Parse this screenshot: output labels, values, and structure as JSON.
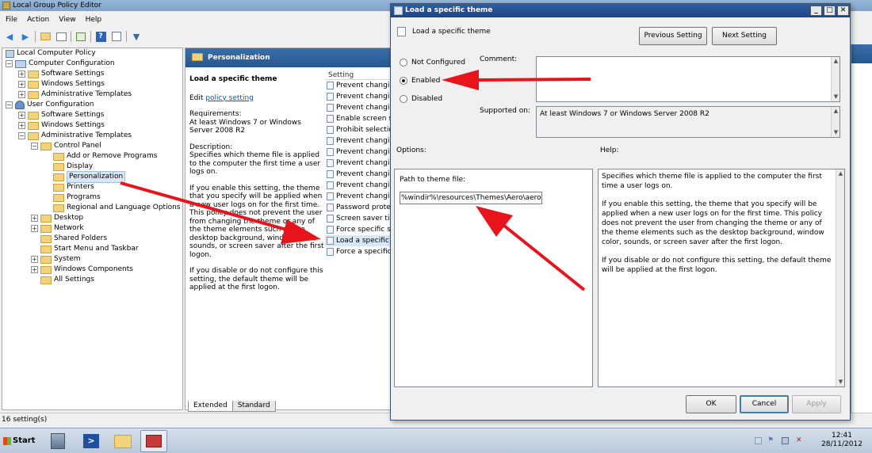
{
  "main_window": {
    "title": "Local Group Policy Editor",
    "menu": [
      "File",
      "Action",
      "View",
      "Help"
    ],
    "toolbar_icons": [
      "back-arrow-icon",
      "forward-arrow-icon",
      "up-folder-icon",
      "show-hide-tree-icon",
      "export-list-icon",
      "help-icon",
      "properties-icon",
      "filter-icon"
    ],
    "tree": [
      {
        "label": "Local Computer Policy",
        "icon": "policy-icon"
      },
      {
        "label": "Computer Configuration",
        "icon": "computer-icon"
      },
      {
        "label": "Software Settings",
        "icon": "folder-icon"
      },
      {
        "label": "Windows Settings",
        "icon": "folder-icon"
      },
      {
        "label": "Administrative Templates",
        "icon": "folder-icon"
      },
      {
        "label": "User Configuration",
        "icon": "user-icon"
      },
      {
        "label": "Software Settings",
        "icon": "folder-icon"
      },
      {
        "label": "Windows Settings",
        "icon": "folder-icon"
      },
      {
        "label": "Administrative Templates",
        "icon": "folder-icon"
      },
      {
        "label": "Control Panel",
        "icon": "folder-icon"
      },
      {
        "label": "Add or Remove Programs",
        "icon": "folder-icon"
      },
      {
        "label": "Display",
        "icon": "folder-icon"
      },
      {
        "label": "Personalization",
        "icon": "folder-icon",
        "selected": true
      },
      {
        "label": "Printers",
        "icon": "folder-icon"
      },
      {
        "label": "Programs",
        "icon": "folder-icon"
      },
      {
        "label": "Regional and Language Options",
        "icon": "folder-icon"
      },
      {
        "label": "Desktop",
        "icon": "folder-icon"
      },
      {
        "label": "Network",
        "icon": "folder-icon"
      },
      {
        "label": "Shared Folders",
        "icon": "folder-icon"
      },
      {
        "label": "Start Menu and Taskbar",
        "icon": "folder-icon"
      },
      {
        "label": "System",
        "icon": "folder-icon"
      },
      {
        "label": "Windows Components",
        "icon": "folder-icon"
      },
      {
        "label": "All Settings",
        "icon": "folder-icon"
      }
    ],
    "panel_header": "Personalization",
    "description": {
      "title": "Load a specific theme",
      "edit_prefix": "Edit",
      "edit_link": "policy setting",
      "requirements_label": "Requirements:",
      "requirements_text": "At least Windows 7 or Windows Server 2008 R2",
      "description_label": "Description:",
      "paragraph1": "Specifies which theme file is applied to the computer the first time a user logs on.",
      "paragraph2": "If you enable this setting, the theme that you specify will be applied when a new user logs on for the first time. This policy does not prevent the user from changing the theme or any of the theme elements such as the desktop background, window color, sounds, or screen saver after the first logon.",
      "paragraph3": "If you disable or do not configure this setting, the default theme will be applied at the first logon."
    },
    "settings_header": "Setting",
    "settings": [
      "Prevent changin",
      "Prevent changin",
      "Prevent changin",
      "Enable screen sa",
      "Prohibit selection",
      "Prevent changin",
      "Prevent changin",
      "Prevent changin",
      "Prevent changin",
      "Prevent changin",
      "Prevent changin",
      "Password protec",
      "Screen saver tim",
      "Force specific sc",
      "Load a specific t",
      "Force a specific"
    ],
    "tabs": [
      "Extended",
      "Standard"
    ],
    "status": "16 setting(s)"
  },
  "dialog": {
    "title": "Load a specific theme",
    "heading": "Load a specific theme",
    "previous_button": "Previous Setting",
    "next_button": "Next Setting",
    "radio_not_configured": "Not Configured",
    "radio_enabled": "Enabled",
    "radio_disabled": "Disabled",
    "selected_option": "Enabled",
    "comment_label": "Comment:",
    "comment_value": "",
    "supported_label": "Supported on:",
    "supported_value": "At least Windows 7 or Windows Server 2008 R2",
    "options_label": "Options:",
    "help_label": "Help:",
    "path_label": "Path to theme file:",
    "path_value": "%windir%\\resources\\Themes\\Aero\\aero",
    "help_p1": "Specifies which theme file is applied to the computer the first time a user logs on.",
    "help_p2": "If you enable this setting, the theme that you specify will be applied when a new user logs on for the first time.  This policy does not prevent the user from changing the theme or any of the theme elements such as the desktop background, window color, sounds, or screen saver after the first logon.",
    "help_p3": "If you disable or do not configure this setting, the default theme will be applied at the first logon.",
    "ok_button": "OK",
    "cancel_button": "Cancel",
    "apply_button": "Apply"
  },
  "taskbar": {
    "start_label": "Start",
    "apps": [
      "server-manager-icon",
      "powershell-icon",
      "explorer-icon",
      "group-policy-icon"
    ],
    "tray_icons": [
      "show-desktop-icon",
      "flag-icon",
      "network-icon",
      "volume-icon"
    ],
    "time": "12:41",
    "date": "28/11/2012"
  },
  "colors": {
    "annotation_arrow": "#e8141b",
    "header_blue": "#27578f",
    "selection": "#d9e6f6"
  }
}
